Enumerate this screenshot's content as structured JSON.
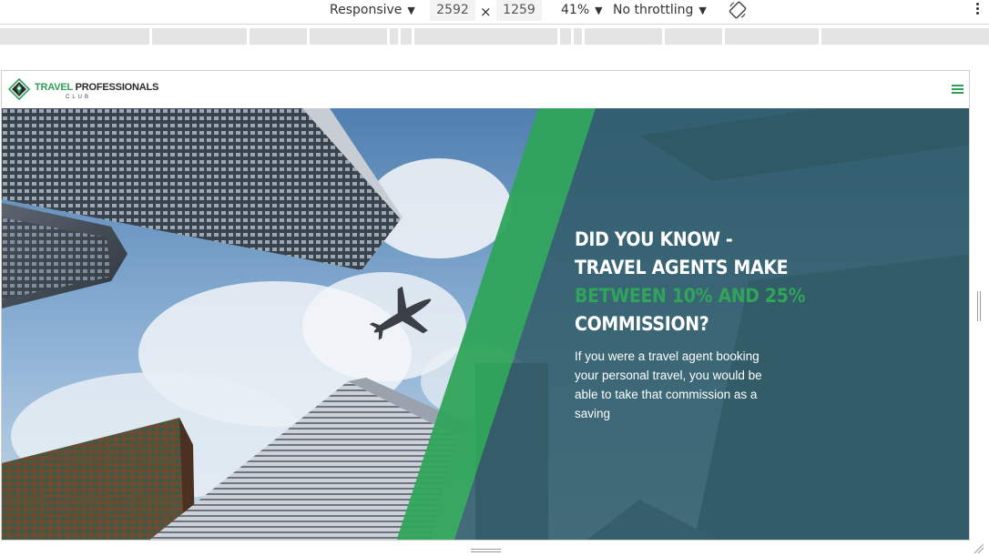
{
  "devtools": {
    "device": "Responsive",
    "width": "2592",
    "times": "×",
    "height": "1259",
    "zoom": "41%",
    "throttling": "No throttling",
    "dropdown_arrow": "▼",
    "icons": [
      "rotate-icon",
      "more-options-icon"
    ]
  },
  "site": {
    "logo": {
      "word1": "TRAVEL",
      "word2": "PROFESSIONALS",
      "sub": "CLUB",
      "icon": "compass-shield-icon"
    },
    "menu_icon": "hamburger-menu-icon",
    "hero": {
      "headline_line1": "DID YOU KNOW -",
      "headline_line2": "TRAVEL AGENTS MAKE",
      "headline_highlight": "BETWEEN 10% AND 25%",
      "headline_line4": "COMMISSION?",
      "body": "If you were a travel agent booking your personal travel, you would be able to take that commission as a saving"
    }
  },
  "colors": {
    "brand_green": "#2f9e56",
    "overlay_teal": "#2d5a66",
    "highlight_green": "#2fa45a"
  }
}
